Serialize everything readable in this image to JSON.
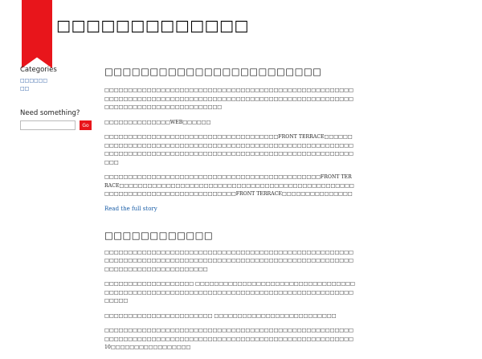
{
  "header": {
    "site_title": "□□□□□□□□□□□□□"
  },
  "sidebar": {
    "categories_title": "Categories",
    "categories": [
      "□□□□□□",
      "□□"
    ],
    "search_title": "Need something?",
    "search_placeholder": "",
    "search_button": "Go"
  },
  "posts": [
    {
      "title": "□□□□□□□□□□□□□□□□□□□□□□□□",
      "paragraphs": [
        "□□□□□□□□□□□□□□□□□□□□□□□□□□□□□□□□□□□□□□□□□□□□□□□□□□□□□□□□□□□□□□□□□□□□□□□□□□□□□□□□□□□□□□□□□□□□□□□□□□□□□□□□□□□□□□□□□□□□□□□□□□□□□□□□□□□",
        "□□□□□□□□□□□□□□WEB□□□□□□",
        "□□□□□□□□□□□□□□□□□□□□□□□□□□□□□□□□□□□□□FRONT TERRACE□□□□□□□□□□□□□□□□□□□□□□□□□□□□□□□□□□□□□□□□□□□□□□□□□□□□□□□□□□□□□□□□□□□□□□□□□□□□□□□□□□□□□□□□□□□□□□□□□□□□□□□□□□□□□□□□□□□",
        "□□□□□□□□□□□□□□□□□□□□□□□□□□□□□□□□□□□□□□□□□□□□□□FRONT TERRACE□□□□□□□□□□□□□□□□□□□□□□□□□□□□□□□□□□□□□□□□□□□□□□□□□□□□□□□□□□□□□□□□□□□□□□□□□□□□□□FRONT TERRACE□□□□□□□□□□□□□□□"
      ],
      "read_more": "Read the full story"
    },
    {
      "title": "□□□□□□□□□□□□",
      "paragraphs": [
        "□□□□□□□□□□□□□□□□□□□□□□□□□□□□□□□□□□□□□□□□□□□□□□□□□□□□□□□□□□□□□□□□□□□□□□□□□□□□□□□□□□□□□□□□□□□□□□□□□□□□□□□□□□□□□□□□□□□□□□□□□□□□□□□□",
        "□□□□□□□□□□□□□□□□□□□ □□□□□□□□□□□□□□□□□□□□□□□□□□□□□□□□□□□□□□□□□□□□□□□□□□□□□□□□□□□□□□□□□□□□□□□□□□□□□□□□□□□□□□□□□□□□",
        "□□□□□□□□□□□□□□□□□□□□□□□ □□□□□□□□□□□□□□□□□□□□□□□□□□",
        "□□□□□□□□□□□□□□□□□□□□□□□□□□□□□□□□□□□□□□□□□□□□□□□□□□□□□□□□□□□□□□□□□□□□□□□□□□□□□□□□□□□□□□□□□□□□□□□□□□□□□□□□□□10□□□□□□□□□□□□□□□□□"
      ]
    }
  ]
}
